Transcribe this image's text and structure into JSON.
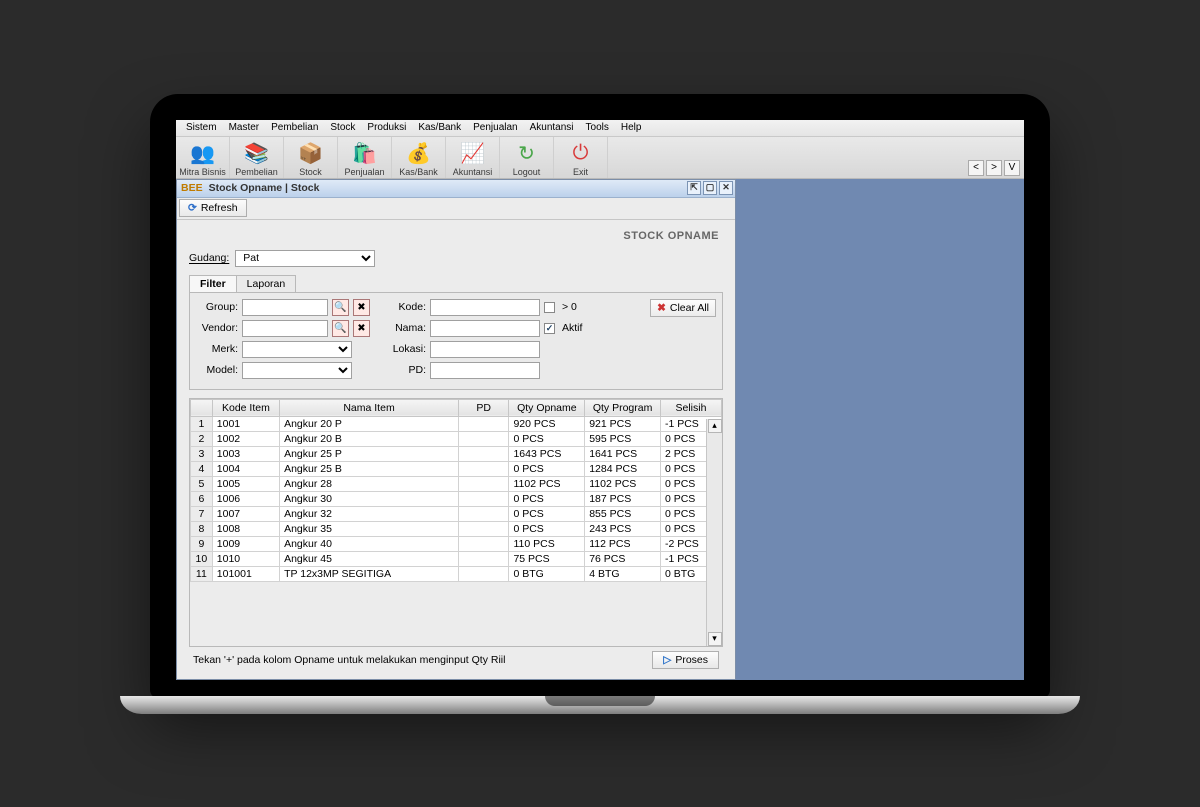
{
  "menubar": [
    "Sistem",
    "Master",
    "Pembelian",
    "Stock",
    "Produksi",
    "Kas/Bank",
    "Penjualan",
    "Akuntansi",
    "Tools",
    "Help"
  ],
  "toolbar": [
    {
      "label": "Mitra Bisnis",
      "icon": "👥",
      "tint": "#6aa6e4"
    },
    {
      "label": "Pembelian",
      "icon": "📚",
      "tint": "#d6a24a"
    },
    {
      "label": "Stock",
      "icon": "📦",
      "tint": "#c98a3f"
    },
    {
      "label": "Penjualan",
      "icon": "🛍️",
      "tint": "#3f6cc9"
    },
    {
      "label": "Kas/Bank",
      "icon": "💰",
      "tint": "#d8a24a"
    },
    {
      "label": "Akuntansi",
      "icon": "📈",
      "tint": "#3dbb6e"
    },
    {
      "label": "Logout",
      "icon": "↻",
      "tint": "#4aa64a"
    },
    {
      "label": "Exit",
      "icon": "⏻",
      "tint": "#d83a3a"
    }
  ],
  "right_buttons": [
    "<",
    ">",
    "V"
  ],
  "internal_window": {
    "brand": "BEE",
    "title": "Stock Opname | Stock",
    "win_buttons": [
      "⇱",
      "▢",
      "✕"
    ]
  },
  "refresh_label": "Refresh",
  "page_title": "STOCK OPNAME",
  "gudang": {
    "label": "Gudang:",
    "value": "Pat"
  },
  "tabs": [
    "Filter",
    "Laporan"
  ],
  "filter": {
    "group_label": "Group:",
    "vendor_label": "Vendor:",
    "merk_label": "Merk:",
    "model_label": "Model:",
    "kode_label": "Kode:",
    "nama_label": "Nama:",
    "lokasi_label": "Lokasi:",
    "pd_label": "PD:",
    "gt0_label": "> 0",
    "aktif_label": "Aktif",
    "clear_all": "Clear All"
  },
  "columns": [
    "",
    "Kode Item",
    "Nama Item",
    "PD",
    "Qty Opname",
    "Qty Program",
    "Selisih"
  ],
  "rows": [
    {
      "n": 1,
      "kode": "1001",
      "nama": "Angkur 20 P",
      "pd": "",
      "op": "920 PCS",
      "prog": "921 PCS",
      "sel": "-1 PCS"
    },
    {
      "n": 2,
      "kode": "1002",
      "nama": "Angkur 20 B",
      "pd": "",
      "op": "0 PCS",
      "prog": "595 PCS",
      "sel": "0 PCS"
    },
    {
      "n": 3,
      "kode": "1003",
      "nama": "Angkur 25 P",
      "pd": "",
      "op": "1643 PCS",
      "prog": "1641 PCS",
      "sel": "2 PCS"
    },
    {
      "n": 4,
      "kode": "1004",
      "nama": "Angkur 25 B",
      "pd": "",
      "op": "0 PCS",
      "prog": "1284 PCS",
      "sel": "0 PCS"
    },
    {
      "n": 5,
      "kode": "1005",
      "nama": "Angkur 28",
      "pd": "",
      "op": "1102 PCS",
      "prog": "1102 PCS",
      "sel": "0 PCS"
    },
    {
      "n": 6,
      "kode": "1006",
      "nama": "Angkur 30",
      "pd": "",
      "op": "0 PCS",
      "prog": "187 PCS",
      "sel": "0 PCS"
    },
    {
      "n": 7,
      "kode": "1007",
      "nama": "Angkur 32",
      "pd": "",
      "op": "0 PCS",
      "prog": "855 PCS",
      "sel": "0 PCS"
    },
    {
      "n": 8,
      "kode": "1008",
      "nama": "Angkur 35",
      "pd": "",
      "op": "0 PCS",
      "prog": "243 PCS",
      "sel": "0 PCS"
    },
    {
      "n": 9,
      "kode": "1009",
      "nama": "Angkur 40",
      "pd": "",
      "op": "110 PCS",
      "prog": "112 PCS",
      "sel": "-2 PCS"
    },
    {
      "n": 10,
      "kode": "1010",
      "nama": "Angkur 45",
      "pd": "",
      "op": "75 PCS",
      "prog": "76 PCS",
      "sel": "-1 PCS"
    },
    {
      "n": 11,
      "kode": "101001",
      "nama": "TP 12x3MP SEGITIGA",
      "pd": "",
      "op": "0 BTG",
      "prog": "4 BTG",
      "sel": "0 BTG"
    }
  ],
  "footer_hint": "Tekan '+' pada kolom Opname untuk melakukan menginput Qty Riil",
  "proses_label": "Proses"
}
